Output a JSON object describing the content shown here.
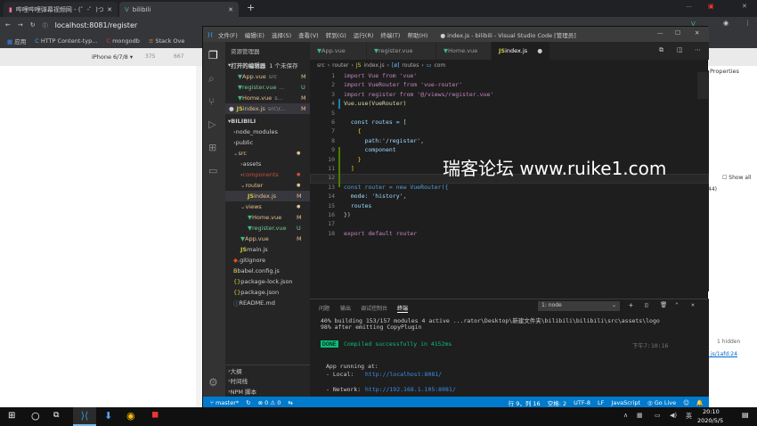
{
  "browser": {
    "tabs": [
      {
        "label": "哔哩哔哩弹幕视频网 - (゜-゜)つロ"
      },
      {
        "label": "bilibili"
      }
    ],
    "new_tab_label": "+",
    "url": "localhost:8081/register",
    "bookmarks": [
      "应用",
      "HTTP Content-typ...",
      "mongodb",
      "Stack Ove"
    ],
    "device_label": "iPhone 6/7/8 ▾",
    "device_w": "375",
    "device_h": "667",
    "devtools": {
      "properties_tab": "Properties",
      "show_all": "Show all",
      "num_44": "44)",
      "hidden": "1 hidden",
      "link": "_js/1afd:24"
    }
  },
  "vscode": {
    "menu": [
      "文件(F)",
      "编辑(E)",
      "选择(S)",
      "查看(V)",
      "转到(G)",
      "运行(R)",
      "终端(T)",
      "帮助(H)"
    ],
    "title": "● index.js - bilibili - Visual Studio Code [管理员]",
    "explorer_title": "资源管理器",
    "open_editors": "打开的编辑器",
    "unsaved": "1 个未保存",
    "open_files": [
      {
        "name": "App.vue",
        "path": "src",
        "flag": "M"
      },
      {
        "name": "register.vue",
        "path": "...",
        "flag": "U"
      },
      {
        "name": "Home.vue",
        "path": "s...",
        "flag": "M"
      },
      {
        "name": "index.js",
        "path": "src\\r...",
        "flag": "M"
      }
    ],
    "project": "BILIBILI",
    "tree": [
      {
        "name": "node_modules",
        "flag": ""
      },
      {
        "name": "public",
        "flag": ""
      },
      {
        "name": "src",
        "flag": "●"
      },
      {
        "name": "assets",
        "flag": ""
      },
      {
        "name": "components",
        "flag": "●"
      },
      {
        "name": "router",
        "flag": "●"
      },
      {
        "name": "index.js",
        "flag": "M"
      },
      {
        "name": "views",
        "flag": "●"
      },
      {
        "name": "Home.vue",
        "flag": "M"
      },
      {
        "name": "register.vue",
        "flag": "U"
      },
      {
        "name": "App.vue",
        "flag": "M"
      },
      {
        "name": "main.js",
        "flag": ""
      },
      {
        "name": ".gitignore",
        "flag": ""
      },
      {
        "name": "babel.config.js",
        "flag": ""
      },
      {
        "name": "package-lock.json",
        "flag": ""
      },
      {
        "name": "package.json",
        "flag": ""
      },
      {
        "name": "README.md",
        "flag": ""
      }
    ],
    "outline": [
      "大纲",
      "时间线",
      "NPM 脚本"
    ],
    "tabs": [
      "App.vue",
      "register.vue",
      "Home.vue",
      "index.js"
    ],
    "breadcrumb": [
      "src",
      "router",
      "index.js",
      "routes",
      "com"
    ],
    "code_lines": [
      "import Vue from 'vue'",
      "import VueRouter from 'vue-router'",
      "import register from '@/views/register.vue'",
      "Vue.use(VueRouter)",
      "",
      "  const routes = [",
      "    {",
      "      path:'/register',",
      "      component",
      "    }",
      "  ]",
      "",
      "const router = new VueRouter({",
      "  mode: 'history',",
      "  routes",
      "})",
      "",
      "export default router"
    ],
    "panel_tabs": [
      "问题",
      "输出",
      "调试控制台",
      "终端"
    ],
    "terminal_select": "1: node",
    "terminal_lines": [
      "40% building 153/157 modules 4 active ...rator\\Desktop\\新建文件夹\\bilibili\\bilibili\\src\\assets\\logo",
      "98% after emitting CopyPlugin"
    ],
    "done_badge": "DONE",
    "compiled": "Compiled successfully in 4152ms",
    "time": "下午7:10:16",
    "app_running": "App running at:",
    "local_label": "- Local:",
    "local_url": "http://localhost:8081/",
    "network_label": "- Network:",
    "network_url": "http://192.168.1.105:8081/",
    "status": {
      "branch": "master*",
      "errors": "⊗ 0 ⚠ 0",
      "position": "行 9，列 16",
      "spaces": "空格: 2",
      "encoding": "UTF-8",
      "eol": "LF",
      "language": "JavaScript",
      "golive": "Go Live"
    }
  },
  "watermark": "瑞客论坛 www.ruike1.com",
  "taskbar": {
    "time": "20:10",
    "date": "2020/5/5",
    "lang": "英"
  }
}
